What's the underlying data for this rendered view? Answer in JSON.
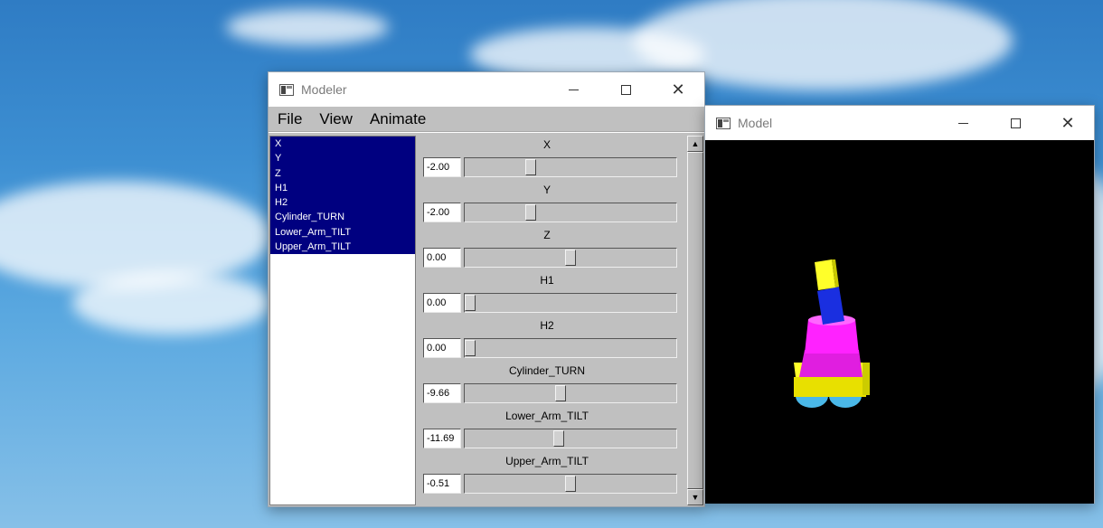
{
  "modeler": {
    "title": "Modeler",
    "menu": [
      "File",
      "View",
      "Animate"
    ],
    "list_items": [
      "X",
      "Y",
      "Z",
      "H1",
      "H2",
      "Cylinder_TURN",
      "Lower_Arm_TILT",
      "Upper_Arm_TILT"
    ],
    "sliders": [
      {
        "label": "X",
        "value": "-2.00",
        "level": 0.3
      },
      {
        "label": "Y",
        "value": "-2.00",
        "level": 0.3
      },
      {
        "label": "Z",
        "value": "0.00",
        "level": 0.5
      },
      {
        "label": "H1",
        "value": "0.00",
        "level": 0.0
      },
      {
        "label": "H2",
        "value": "0.00",
        "level": 0.0
      },
      {
        "label": "Cylinder_TURN",
        "value": "-9.66",
        "level": 0.45
      },
      {
        "label": "Lower_Arm_TILT",
        "value": "-11.69",
        "level": 0.44
      },
      {
        "label": "Upper_Arm_TILT",
        "value": "-0.51",
        "level": 0.5
      }
    ]
  },
  "model": {
    "title": "Model",
    "colors": {
      "base": "#ffff2a",
      "body": "#ff22ff",
      "arm": "#1a2fe0",
      "wheel": "#4ab8e8",
      "background": "#000000"
    }
  }
}
